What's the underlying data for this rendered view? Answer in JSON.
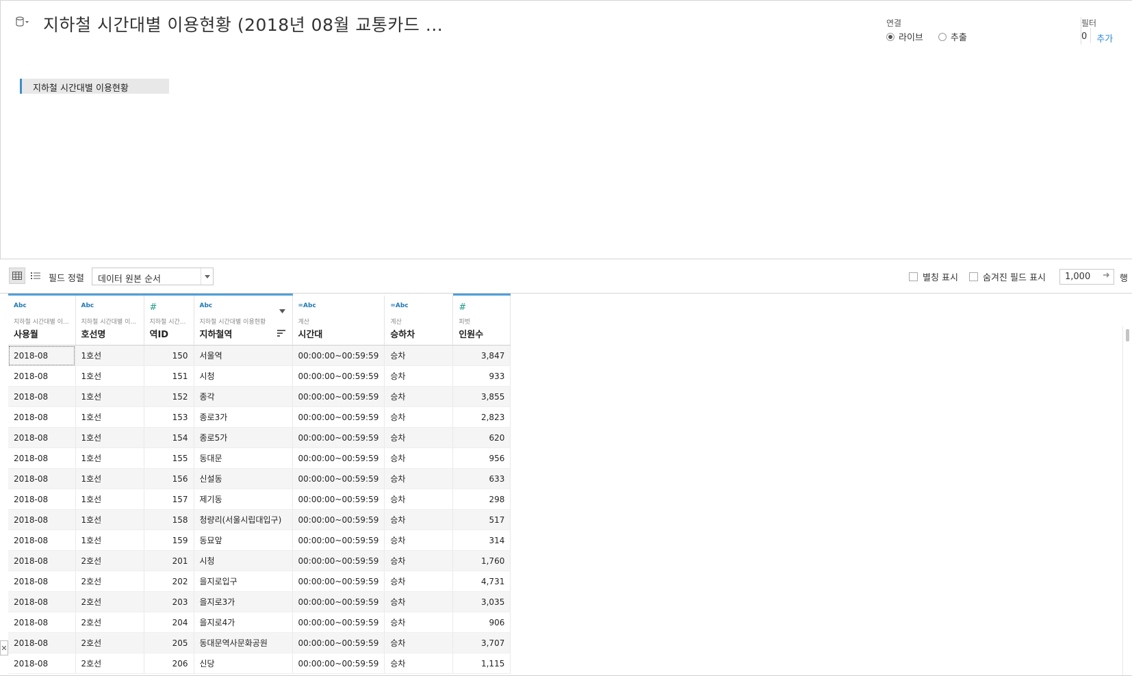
{
  "header": {
    "title": "지하철 시간대별 이용현황 (2018년 08월  교통카드 ...",
    "connection": {
      "label": "연결",
      "options": [
        {
          "label": "라이브",
          "selected": true
        },
        {
          "label": "추출",
          "selected": false
        }
      ]
    },
    "filter": {
      "label": "필터",
      "count": "0",
      "add_label": "추가"
    },
    "table_pill": "지하철 시간대별 이용현황"
  },
  "toolbar": {
    "sort_label": "필드 정렬",
    "sort_value": "데이터 원본 순서",
    "alias_label": "별칭 표시",
    "hidden_label": "숨겨진 필드 표시",
    "rows_value": "1,000",
    "rows_label": "행"
  },
  "columns": [
    {
      "type": "Abc",
      "source": "지하철 시간대별 이...",
      "name": "사용월"
    },
    {
      "type": "Abc",
      "source": "지하철 시간대별 이...",
      "name": "호선명"
    },
    {
      "type": "#",
      "source": "지하철 시간...",
      "name": "역ID"
    },
    {
      "type": "Abc",
      "source": "지하철 시간대별 이용현황",
      "name": "지하철역"
    },
    {
      "type": "=Abc",
      "source": "계산",
      "name": "시간대"
    },
    {
      "type": "=Abc",
      "source": "계산",
      "name": "승하차"
    },
    {
      "type": "#",
      "source": "피벗",
      "name": "인원수"
    }
  ],
  "rows": [
    [
      "2018-08",
      "1호선",
      "150",
      "서울역",
      "00:00:00~00:59:59",
      "승차",
      "3,847"
    ],
    [
      "2018-08",
      "1호선",
      "151",
      "시청",
      "00:00:00~00:59:59",
      "승차",
      "933"
    ],
    [
      "2018-08",
      "1호선",
      "152",
      "종각",
      "00:00:00~00:59:59",
      "승차",
      "3,855"
    ],
    [
      "2018-08",
      "1호선",
      "153",
      "종로3가",
      "00:00:00~00:59:59",
      "승차",
      "2,823"
    ],
    [
      "2018-08",
      "1호선",
      "154",
      "종로5가",
      "00:00:00~00:59:59",
      "승차",
      "620"
    ],
    [
      "2018-08",
      "1호선",
      "155",
      "동대문",
      "00:00:00~00:59:59",
      "승차",
      "956"
    ],
    [
      "2018-08",
      "1호선",
      "156",
      "신설동",
      "00:00:00~00:59:59",
      "승차",
      "633"
    ],
    [
      "2018-08",
      "1호선",
      "157",
      "제기동",
      "00:00:00~00:59:59",
      "승차",
      "298"
    ],
    [
      "2018-08",
      "1호선",
      "158",
      "청량리(서울시립대입구)",
      "00:00:00~00:59:59",
      "승차",
      "517"
    ],
    [
      "2018-08",
      "1호선",
      "159",
      "동묘앞",
      "00:00:00~00:59:59",
      "승차",
      "314"
    ],
    [
      "2018-08",
      "2호선",
      "201",
      "시청",
      "00:00:00~00:59:59",
      "승차",
      "1,760"
    ],
    [
      "2018-08",
      "2호선",
      "202",
      "을지로입구",
      "00:00:00~00:59:59",
      "승차",
      "4,731"
    ],
    [
      "2018-08",
      "2호선",
      "203",
      "을지로3가",
      "00:00:00~00:59:59",
      "승차",
      "3,035"
    ],
    [
      "2018-08",
      "2호선",
      "204",
      "을지로4가",
      "00:00:00~00:59:59",
      "승차",
      "906"
    ],
    [
      "2018-08",
      "2호선",
      "205",
      "동대문역사문화공원",
      "00:00:00~00:59:59",
      "승차",
      "3,707"
    ],
    [
      "2018-08",
      "2호선",
      "206",
      "신당",
      "00:00:00~00:59:59",
      "승차",
      "1,115"
    ]
  ]
}
